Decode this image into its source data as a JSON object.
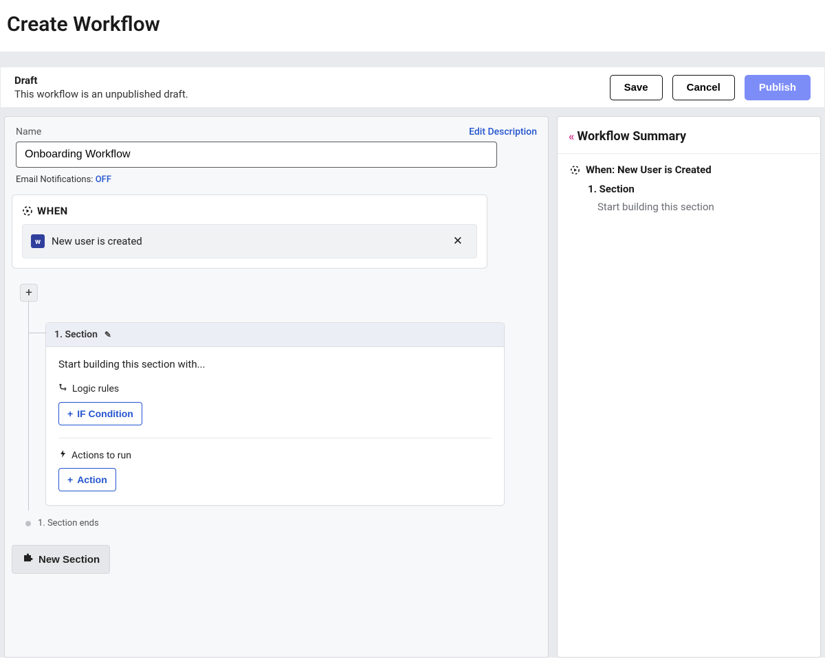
{
  "page_title": "Create Workflow",
  "status": {
    "title": "Draft",
    "subtitle": "This workflow is an unpublished draft.",
    "save": "Save",
    "cancel": "Cancel",
    "publish": "Publish"
  },
  "name": {
    "label": "Name",
    "value": "Onboarding Workflow",
    "edit_description": "Edit Description"
  },
  "email_notifications": {
    "label": "Email Notifications:",
    "value": "OFF"
  },
  "when": {
    "label": "WHEN",
    "trigger_text": "New user is created",
    "trigger_icon_letter": "w"
  },
  "section": {
    "header": "1.  Section",
    "hint": "Start building this section with...",
    "logic_label": "Logic rules",
    "if_condition_btn": "IF Condition",
    "actions_label": "Actions to run",
    "action_btn": "Action",
    "ends_label": "1. Section ends"
  },
  "new_section_btn": "New Section",
  "summary": {
    "title": "Workflow Summary",
    "when_line": "When: New User is Created",
    "section_line": "1. Section",
    "sub_line": "Start building this section"
  }
}
